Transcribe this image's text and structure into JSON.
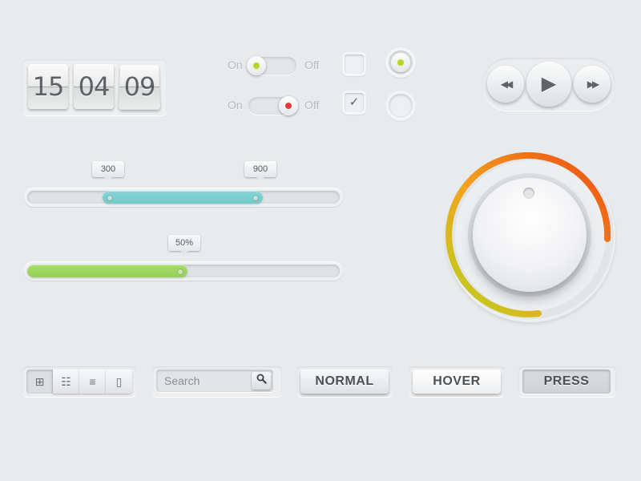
{
  "clock": {
    "hours": "15",
    "minutes": "04",
    "seconds": "09"
  },
  "toggles": [
    {
      "on_label": "On",
      "off_label": "Off",
      "state": "on",
      "indicator_color": "#b8d41e"
    },
    {
      "on_label": "On",
      "off_label": "Off",
      "state": "off",
      "indicator_color": "#e8393c"
    }
  ],
  "checkboxes": [
    {
      "checked": false
    },
    {
      "checked": true,
      "check_icon": "checkmark-icon",
      "glyph": "✓"
    }
  ],
  "radios": [
    {
      "selected": true,
      "indicator_color": "#b8d41e"
    },
    {
      "selected": false
    }
  ],
  "media": {
    "rewind_icon": "rewind-icon",
    "rewind_glyph": "◀◀",
    "play_icon": "play-icon",
    "play_glyph": "▶",
    "forward_icon": "fast-forward-icon",
    "forward_glyph": "▶▶"
  },
  "range_slider": {
    "min_label": "300",
    "max_label": "900",
    "low": 300,
    "high": 900,
    "fill_color": "#86d6d8"
  },
  "progress_slider": {
    "label": "50%",
    "value": 0.5,
    "fill_color": "#a8dd6c"
  },
  "knob": {
    "arc_colors": [
      "#b8d41e",
      "#f2a21c",
      "#ec4a14"
    ]
  },
  "view_switcher": [
    {
      "name": "grid-view-icon",
      "glyph": "⊞",
      "active": true
    },
    {
      "name": "detail-list-view-icon",
      "glyph": "☷",
      "active": false
    },
    {
      "name": "list-view-icon",
      "glyph": "≡",
      "active": false
    },
    {
      "name": "cover-flow-view-icon",
      "glyph": "▯",
      "active": false
    }
  ],
  "search": {
    "placeholder": "Search",
    "icon": "search-icon",
    "glyph": "🔍"
  },
  "buttons": {
    "normal": "NORMAL",
    "hover": "HOVER",
    "press": "PRESS"
  }
}
